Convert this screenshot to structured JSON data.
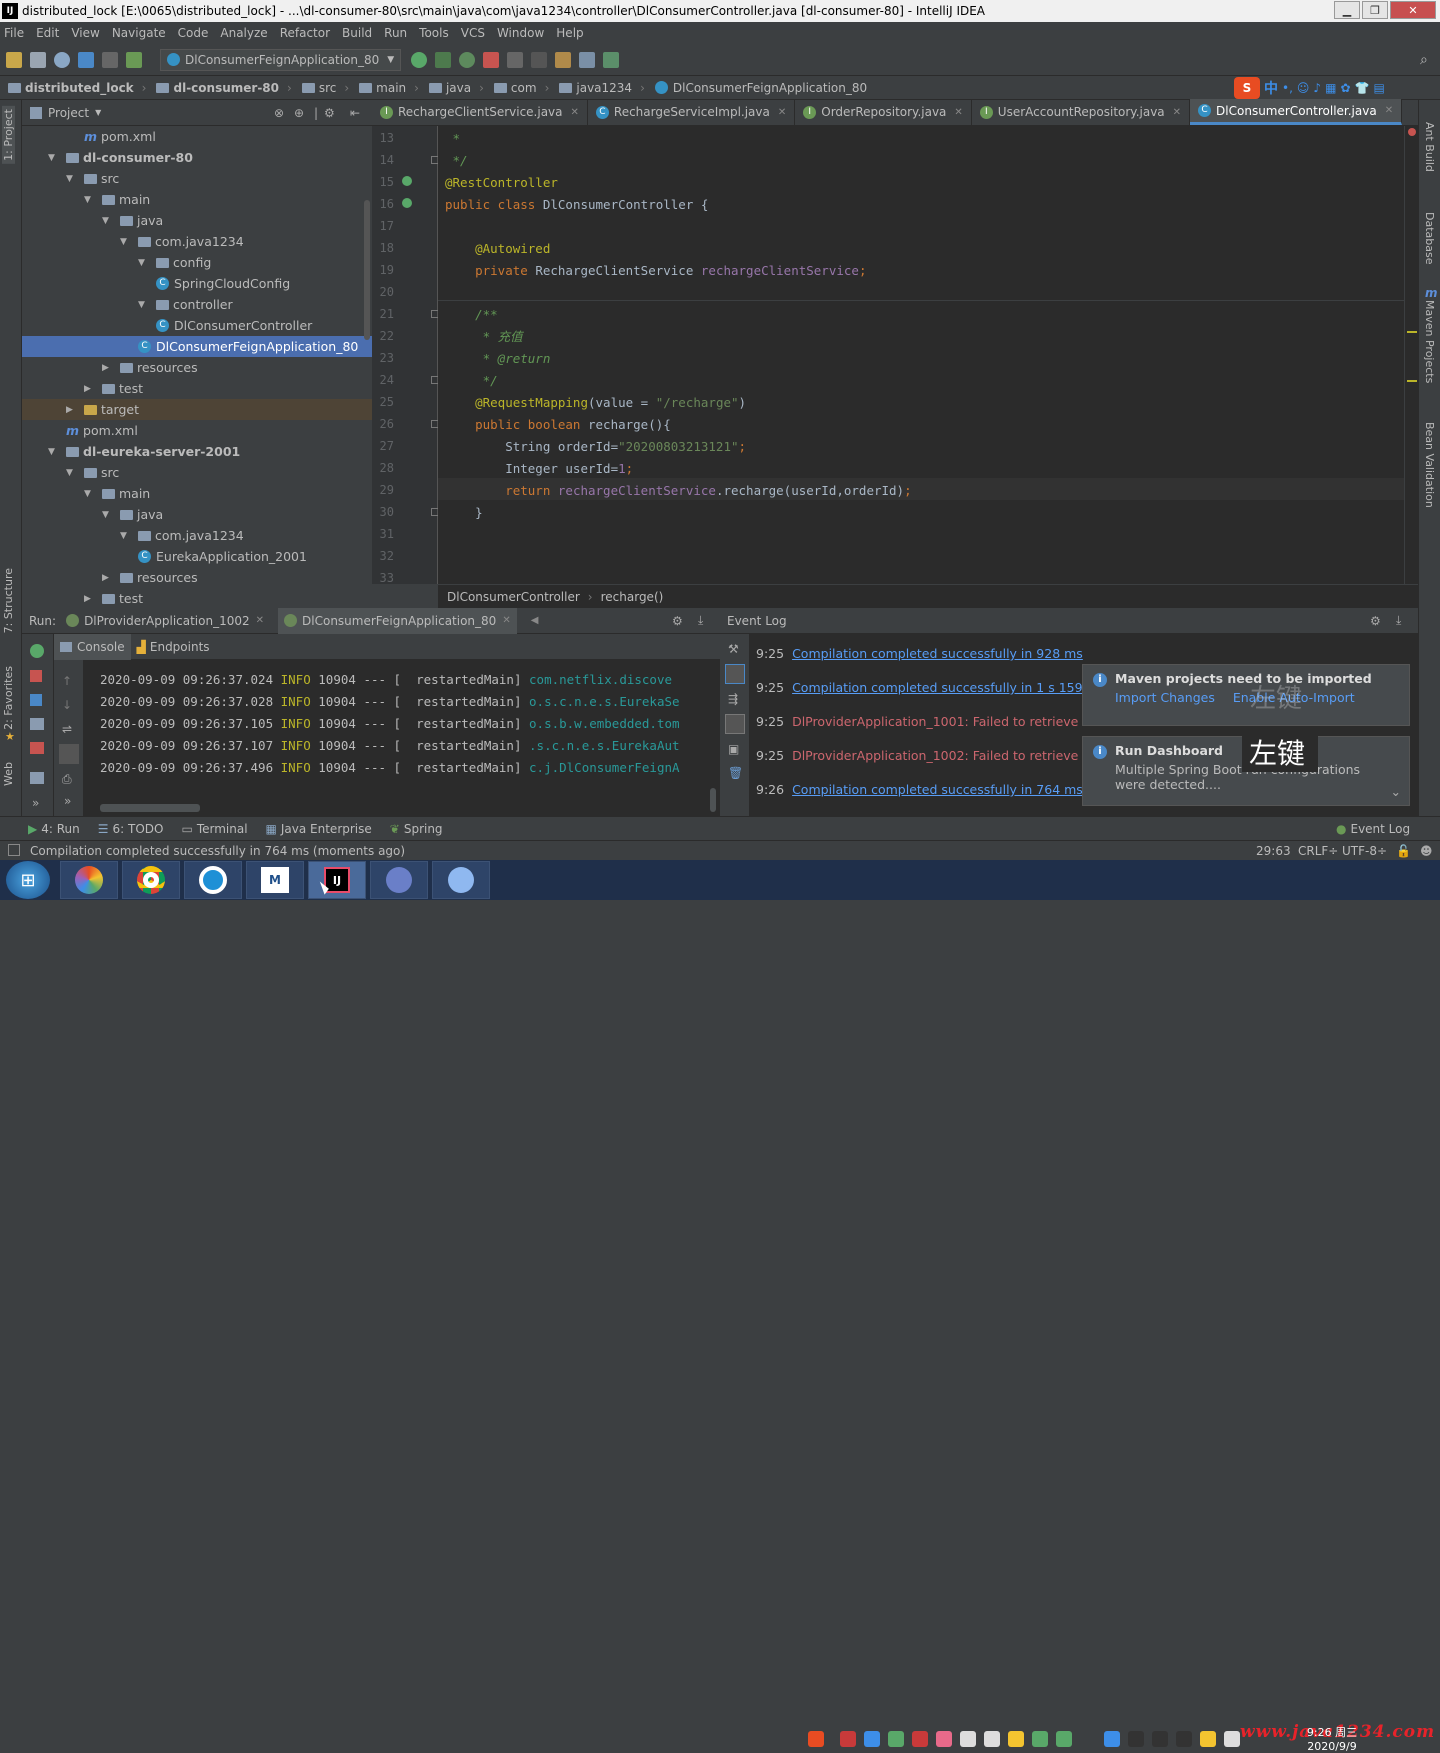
{
  "window": {
    "title": "distributed_lock [E:\\0065\\distributed_lock] - ...\\dl-consumer-80\\src\\main\\java\\com\\java1234\\controller\\DlConsumerController.java [dl-consumer-80] - IntelliJ IDEA",
    "logo": "IJ"
  },
  "menu": [
    "File",
    "Edit",
    "View",
    "Navigate",
    "Code",
    "Analyze",
    "Refactor",
    "Build",
    "Run",
    "Tools",
    "VCS",
    "Window",
    "Help"
  ],
  "toolbar": {
    "run_config": "DlConsumerFeignApplication_80"
  },
  "navbar": [
    "distributed_lock",
    "dl-consumer-80",
    "src",
    "main",
    "java",
    "com",
    "java1234",
    "DlConsumerFeignApplication_80"
  ],
  "ime": {
    "label": "中"
  },
  "left_tabs": {
    "project": "1: Project",
    "structure": "7: Structure",
    "favorites": "2: Favorites",
    "web": "Web"
  },
  "right_tabs": {
    "ant": "Ant Build",
    "database": "Database",
    "maven": "Maven Projects",
    "bean": "Bean Validation"
  },
  "project": {
    "header": "Project",
    "tree": [
      {
        "label": "pom.xml",
        "type": "m",
        "depth": 3
      },
      {
        "label": "dl-consumer-80",
        "type": "module",
        "depth": 1,
        "open": true,
        "bold": true
      },
      {
        "label": "src",
        "type": "folder",
        "depth": 2,
        "open": true
      },
      {
        "label": "main",
        "type": "folder",
        "depth": 3,
        "open": true
      },
      {
        "label": "java",
        "type": "folder",
        "depth": 4,
        "open": true
      },
      {
        "label": "com.java1234",
        "type": "folder",
        "depth": 5,
        "open": true
      },
      {
        "label": "config",
        "type": "folder",
        "depth": 6,
        "open": true
      },
      {
        "label": "SpringCloudConfig",
        "type": "class",
        "depth": 7
      },
      {
        "label": "controller",
        "type": "folder",
        "depth": 6,
        "open": true
      },
      {
        "label": "DlConsumerController",
        "type": "class",
        "depth": 7
      },
      {
        "label": "DlConsumerFeignApplication_80",
        "type": "class",
        "depth": 6,
        "selected": true
      },
      {
        "label": "resources",
        "type": "folder",
        "depth": 4,
        "open": false
      },
      {
        "label": "test",
        "type": "folder",
        "depth": 3,
        "open": false
      },
      {
        "label": "target",
        "type": "folder",
        "depth": 2,
        "open": false,
        "target": true
      },
      {
        "label": "pom.xml",
        "type": "m",
        "depth": 2
      },
      {
        "label": "dl-eureka-server-2001",
        "type": "module",
        "depth": 1,
        "open": true,
        "bold": true
      },
      {
        "label": "src",
        "type": "folder",
        "depth": 2,
        "open": true
      },
      {
        "label": "main",
        "type": "folder",
        "depth": 3,
        "open": true
      },
      {
        "label": "java",
        "type": "folder",
        "depth": 4,
        "open": true
      },
      {
        "label": "com.java1234",
        "type": "folder",
        "depth": 5,
        "open": true
      },
      {
        "label": "EurekaApplication_2001",
        "type": "class",
        "depth": 6
      },
      {
        "label": "resources",
        "type": "folder",
        "depth": 4,
        "open": false
      },
      {
        "label": "test",
        "type": "folder",
        "depth": 3,
        "open": false
      }
    ]
  },
  "editor": {
    "tabs": [
      {
        "label": "RechargeClientService.java",
        "icon": "interface"
      },
      {
        "label": "RechargeServiceImpl.java",
        "icon": "class"
      },
      {
        "label": "OrderRepository.java",
        "icon": "interface"
      },
      {
        "label": "UserAccountRepository.java",
        "icon": "interface"
      },
      {
        "label": "DlConsumerController.java",
        "icon": "class",
        "active": true
      }
    ],
    "first_line": 13,
    "lines": [
      [
        [
          "cm",
          " *"
        ]
      ],
      [
        [
          "cm",
          " */"
        ]
      ],
      [
        [
          "an",
          "@RestController"
        ]
      ],
      [
        [
          "kw",
          "public class "
        ],
        [
          "",
          "DlConsumerController {"
        ]
      ],
      [],
      [
        [
          "an",
          "    @Autowired"
        ]
      ],
      [
        [
          "kw",
          "    private "
        ],
        [
          "",
          "RechargeClientService "
        ],
        [
          "fd",
          "rechargeClientService"
        ],
        [
          "kw",
          ";"
        ]
      ],
      [],
      [
        [
          "cm",
          "    /**"
        ]
      ],
      [
        [
          "cm",
          "     * 充值"
        ]
      ],
      [
        [
          "cm",
          "     * @return"
        ]
      ],
      [
        [
          "cm",
          "     */"
        ]
      ],
      [
        [
          "an",
          "    @RequestMapping"
        ],
        [
          "",
          "(value = "
        ],
        [
          "st",
          "\"/recharge\""
        ],
        [
          "",
          ")"
        ]
      ],
      [
        [
          "kw",
          "    public boolean "
        ],
        [
          "",
          "recharge(){"
        ]
      ],
      [
        [
          "",
          "        String orderId="
        ],
        [
          "st",
          "\"20200803213121\""
        ],
        [
          "kw",
          ";"
        ]
      ],
      [
        [
          "",
          "        Integer userId="
        ],
        [
          "fd",
          "1"
        ],
        [
          "kw",
          ";"
        ]
      ],
      [
        [
          "kw",
          "        return "
        ],
        [
          "fd",
          "rechargeClientService"
        ],
        [
          "",
          ".recharge(userId,orderId)"
        ],
        [
          "kw",
          ";"
        ]
      ],
      [
        [
          "",
          "    }"
        ]
      ],
      [],
      [],
      []
    ],
    "breadcrumb": [
      "DlConsumerController",
      "recharge()"
    ]
  },
  "run": {
    "label": "Run:",
    "tabs": [
      "DlProviderApplication_1002",
      "DlConsumerFeignApplication_80"
    ],
    "subtabs": [
      "Console",
      "Endpoints"
    ],
    "lines": [
      {
        "ts": "2020-09-09 09:26:37.024",
        "level": "INFO",
        "pid": "10904",
        "sep": "---",
        "thread": "[  restartedMain]",
        "cls": "com.netflix.discove"
      },
      {
        "ts": "2020-09-09 09:26:37.028",
        "level": "INFO",
        "pid": "10904",
        "sep": "---",
        "thread": "[  restartedMain]",
        "cls": "o.s.c.n.e.s.EurekaSe"
      },
      {
        "ts": "2020-09-09 09:26:37.105",
        "level": "INFO",
        "pid": "10904",
        "sep": "---",
        "thread": "[  restartedMain]",
        "cls": "o.s.b.w.embedded.tom"
      },
      {
        "ts": "2020-09-09 09:26:37.107",
        "level": "INFO",
        "pid": "10904",
        "sep": "---",
        "thread": "[  restartedMain]",
        "cls": ".s.c.n.e.s.EurekaAut"
      },
      {
        "ts": "2020-09-09 09:26:37.496",
        "level": "INFO",
        "pid": "10904",
        "sep": "---",
        "thread": "[  restartedMain]",
        "cls": "c.j.DlConsumerFeignA"
      }
    ]
  },
  "eventlog": {
    "title": "Event Log",
    "entries": [
      {
        "time": "9:25",
        "text": "Compilation completed successfully in 928 ms",
        "kind": "link"
      },
      {
        "time": "9:25",
        "text": "Compilation completed successfully in 1 s 159 ms",
        "kind": "link"
      },
      {
        "time": "9:25",
        "text": "DlProviderApplication_1001: Failed to retrieve 'hea",
        "kind": "error"
      },
      {
        "time": "9:25",
        "text": "DlProviderApplication_1002: Failed to retrieve 'hea",
        "kind": "error"
      },
      {
        "time": "9:26",
        "text": "Compilation completed successfully in 764 ms",
        "kind": "link"
      }
    ],
    "balloon1": {
      "title": "Maven projects need to be imported",
      "link1": "Import Changes",
      "link2": "Enable Auto-Import"
    },
    "balloon2": {
      "title": "Run Dashboard",
      "line1": "Multiple Spring Boot run configurations",
      "line2": "were detected...."
    },
    "overlay_text": "左键",
    "overlay_faint": "左键"
  },
  "toolwindows": {
    "run": "4: Run",
    "todo": "6: TODO",
    "terminal": "Terminal",
    "javaee": "Java Enterprise",
    "spring": "Spring",
    "eventlog": "Event Log"
  },
  "status": {
    "message": "Compilation completed successfully in 764 ms (moments ago)",
    "position": "29:63",
    "crlf": "CRLF÷",
    "encoding": "UTF-8÷"
  },
  "taskbar": {
    "time": "9:26 周三",
    "date": "2020/9/9",
    "watermark": "www.java1234.com"
  }
}
